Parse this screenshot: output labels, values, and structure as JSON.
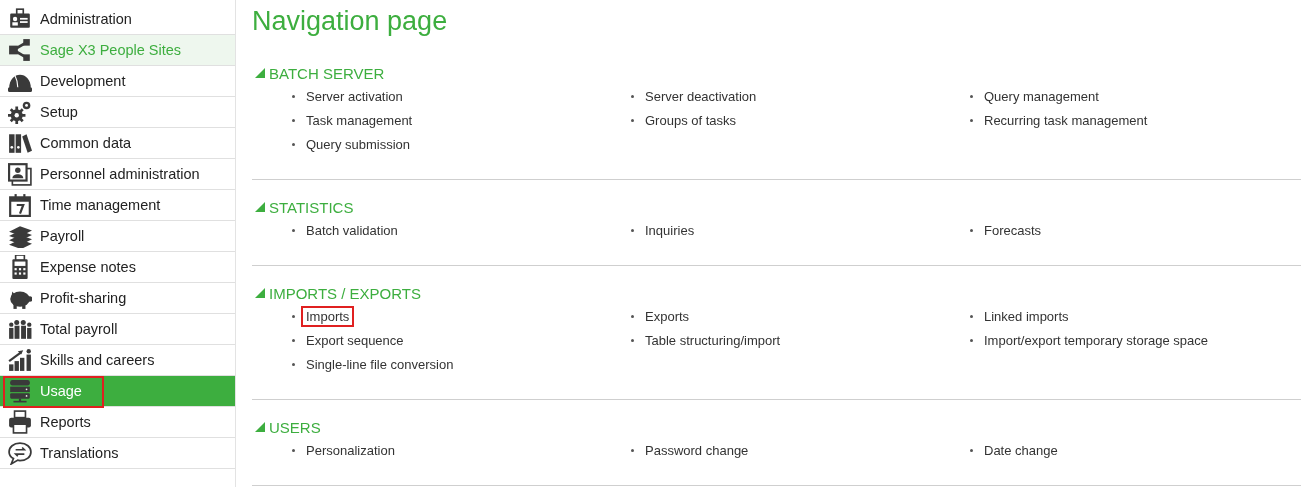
{
  "sidebar": {
    "items": [
      {
        "label": "Administration",
        "selected": false,
        "hovered": false,
        "outlined": false
      },
      {
        "label": "Sage X3 People Sites",
        "selected": false,
        "hovered": true,
        "outlined": false
      },
      {
        "label": "Development",
        "selected": false,
        "hovered": false,
        "outlined": false
      },
      {
        "label": "Setup",
        "selected": false,
        "hovered": false,
        "outlined": false
      },
      {
        "label": "Common data",
        "selected": false,
        "hovered": false,
        "outlined": false
      },
      {
        "label": "Personnel administration",
        "selected": false,
        "hovered": false,
        "outlined": false
      },
      {
        "label": "Time management",
        "selected": false,
        "hovered": false,
        "outlined": false
      },
      {
        "label": "Payroll",
        "selected": false,
        "hovered": false,
        "outlined": false
      },
      {
        "label": "Expense notes",
        "selected": false,
        "hovered": false,
        "outlined": false
      },
      {
        "label": "Profit-sharing",
        "selected": false,
        "hovered": false,
        "outlined": false
      },
      {
        "label": "Total payroll",
        "selected": false,
        "hovered": false,
        "outlined": false
      },
      {
        "label": "Skills and careers",
        "selected": false,
        "hovered": false,
        "outlined": false
      },
      {
        "label": "Usage",
        "selected": true,
        "hovered": false,
        "outlined": true
      },
      {
        "label": "Reports",
        "selected": false,
        "hovered": false,
        "outlined": false
      },
      {
        "label": "Translations",
        "selected": false,
        "hovered": false,
        "outlined": false
      }
    ]
  },
  "page": {
    "title": "Navigation page",
    "sections": [
      {
        "title": "BATCH SERVER",
        "expanded": true,
        "links": [
          {
            "label": "Server activation",
            "outlined": false
          },
          {
            "label": "Server deactivation",
            "outlined": false
          },
          {
            "label": "Query management",
            "outlined": false
          },
          {
            "label": "Task management",
            "outlined": false
          },
          {
            "label": "Groups of tasks",
            "outlined": false
          },
          {
            "label": "Recurring task management",
            "outlined": false
          },
          {
            "label": "Query submission",
            "outlined": false
          }
        ]
      },
      {
        "title": "STATISTICS",
        "expanded": true,
        "links": [
          {
            "label": "Batch validation",
            "outlined": false
          },
          {
            "label": "Inquiries",
            "outlined": false
          },
          {
            "label": "Forecasts",
            "outlined": false
          }
        ]
      },
      {
        "title": "IMPORTS / EXPORTS",
        "expanded": true,
        "links": [
          {
            "label": "Imports",
            "outlined": true
          },
          {
            "label": "Exports",
            "outlined": false
          },
          {
            "label": "Linked imports",
            "outlined": false
          },
          {
            "label": "Export sequence",
            "outlined": false
          },
          {
            "label": "Table structuring/import",
            "outlined": false
          },
          {
            "label": "Import/export temporary storage space",
            "outlined": false
          },
          {
            "label": "Single-line file conversion",
            "outlined": false
          }
        ]
      },
      {
        "title": "USERS",
        "expanded": true,
        "links": [
          {
            "label": "Personalization",
            "outlined": false
          },
          {
            "label": "Password change",
            "outlined": false
          },
          {
            "label": "Date change",
            "outlined": false
          }
        ]
      }
    ]
  }
}
